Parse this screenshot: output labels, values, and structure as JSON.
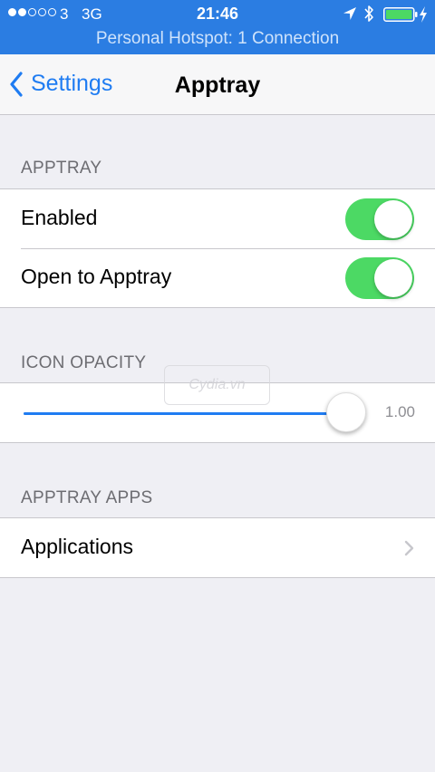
{
  "status_bar": {
    "signal_dots_filled": 2,
    "signal_dots_total": 5,
    "carrier": "3",
    "network": "3G",
    "time": "21:46",
    "hotspot_text": "Personal Hotspot: 1 Connection",
    "background_color": "#2b7de2"
  },
  "nav": {
    "back_label": "Settings",
    "title": "Apptray"
  },
  "sections": {
    "apptray": {
      "header": "APPTRAY",
      "rows": [
        {
          "label": "Enabled",
          "toggle_on": true
        },
        {
          "label": "Open to Apptray",
          "toggle_on": true
        }
      ]
    },
    "icon_opacity": {
      "header": "ICON OPACITY",
      "slider_value": 1.0,
      "slider_value_text": "1.00"
    },
    "apptray_apps": {
      "header": "APPTRAY APPS",
      "rows": [
        {
          "label": "Applications"
        }
      ]
    }
  },
  "watermark": "Cydia.vn",
  "colors": {
    "accent": "#1f7cf2",
    "toggle_on": "#4cd964",
    "background": "#efeff4"
  }
}
